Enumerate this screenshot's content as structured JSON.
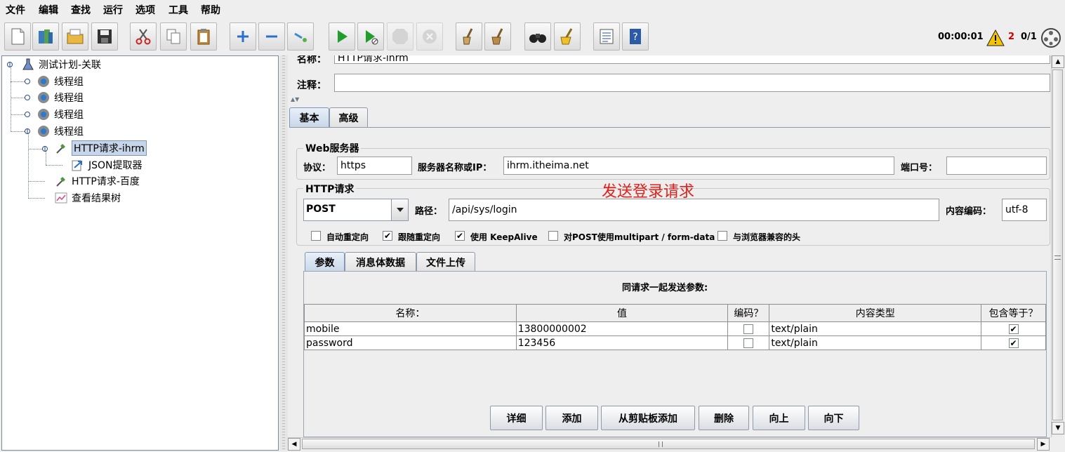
{
  "menu": [
    "文件",
    "编辑",
    "查找",
    "运行",
    "选项",
    "工具",
    "帮助"
  ],
  "status": {
    "timer": "00:00:01",
    "warnings": "2",
    "threads": "0/1"
  },
  "tree": {
    "plan": "测试计划-关联",
    "groups": [
      "线程组",
      "线程组",
      "线程组",
      "线程组"
    ],
    "http_ihrm": "HTTP请求-ihrm",
    "json_extractor": "JSON提取器",
    "http_baidu": "HTTP请求-百度",
    "result_tree": "查看结果树"
  },
  "form": {
    "name_label": "名称：",
    "name_value": "HTTP请求-ihrm",
    "comment_label": "注释：",
    "comment_value": "",
    "tabs": [
      "基本",
      "高级"
    ],
    "web_server_title": "Web服务器",
    "protocol_label": "协议：",
    "protocol_value": "https",
    "server_label": "服务器名称或IP：",
    "server_value": "ihrm.itheima.net",
    "port_label": "端口号：",
    "port_value": "",
    "http_title": "HTTP请求",
    "annotation": "发送登录请求",
    "method": "POST",
    "path_label": "路径：",
    "path_value": "/api/sys/login",
    "encoding_label": "内容编码：",
    "encoding_value": "utf-8",
    "options": [
      {
        "label": "自动重定向",
        "checked": false
      },
      {
        "label": "跟随重定向",
        "checked": true
      },
      {
        "label": "使用 KeepAlive",
        "checked": true
      },
      {
        "label": "对POST使用multipart / form-data",
        "checked": false
      },
      {
        "label": "与浏览器兼容的头",
        "checked": false
      }
    ],
    "sub_tabs": [
      "参数",
      "消息体数据",
      "文件上传"
    ],
    "params_title": "同请求一起发送参数:",
    "columns": [
      "名称：",
      "值",
      "编码？",
      "内容类型",
      "包含等于？"
    ],
    "rows": [
      {
        "name": "mobile",
        "value": "13800000002",
        "type": "text/plain"
      },
      {
        "name": "password",
        "value": "123456",
        "type": "text/plain"
      }
    ],
    "check_mark": "✔",
    "buttons": [
      "详细",
      "添加",
      "从剪贴板添加",
      "删除",
      "向上",
      "向下"
    ]
  },
  "colors": {
    "annotation": "#e0201b",
    "warning": "#d00000",
    "selection": "#c7d5e8"
  }
}
